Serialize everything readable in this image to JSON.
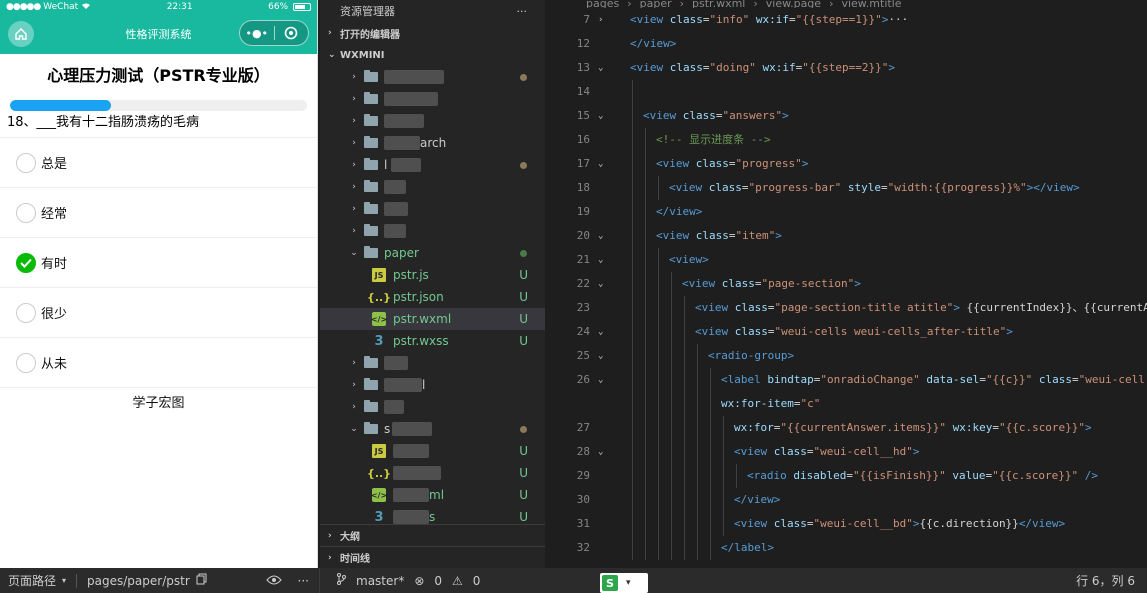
{
  "simulator": {
    "status": {
      "carrier": "WeChat",
      "time": "22:31",
      "battery": "66%"
    },
    "nav": {
      "title": "性格评测系统"
    },
    "page_title": "心理压力测试（PSTR专业版）",
    "progress": 0.34,
    "question": "18、___我有十二指肠溃疡的毛病",
    "options": [
      {
        "label": "总是",
        "checked": false
      },
      {
        "label": "经常",
        "checked": false
      },
      {
        "label": "有时",
        "checked": true
      },
      {
        "label": "很少",
        "checked": false
      },
      {
        "label": "从未",
        "checked": false
      }
    ],
    "footer": "学子宏图"
  },
  "explorer": {
    "header": "资源管理器",
    "more": "···",
    "open_editors": "打开的编辑器",
    "project": "WXMINI",
    "folder_paper": "paper",
    "files_paper": [
      {
        "name": "pstr.js",
        "type": "js",
        "badge": "U"
      },
      {
        "name": "pstr.json",
        "type": "json",
        "badge": "U"
      },
      {
        "name": "pstr.wxml",
        "type": "wxml",
        "badge": "U"
      },
      {
        "name": "pstr.wxss",
        "type": "wxss",
        "badge": "U"
      }
    ],
    "partial_search": "arch",
    "partial_l": "l",
    "partial_s": "s",
    "partial_ml": "ml",
    "partial_xss": "s",
    "outline": "大纲",
    "timeline": "时间线"
  },
  "editor": {
    "breadcrumbs": [
      "pages",
      "paper",
      "pstr.wxml",
      "view.page",
      "view.mtitle"
    ]
  },
  "statusbar": {
    "page_path_label": "页面路径",
    "page_path": "pages/paper/pstr",
    "branch": "master*",
    "errors": "0",
    "warnings": "0",
    "position": "行 6，列 6"
  },
  "colors": {
    "nav": "#19b9a0",
    "progress": "#1aa3f3",
    "radio_checked": "#09bb07",
    "untracked": "#73c991"
  }
}
